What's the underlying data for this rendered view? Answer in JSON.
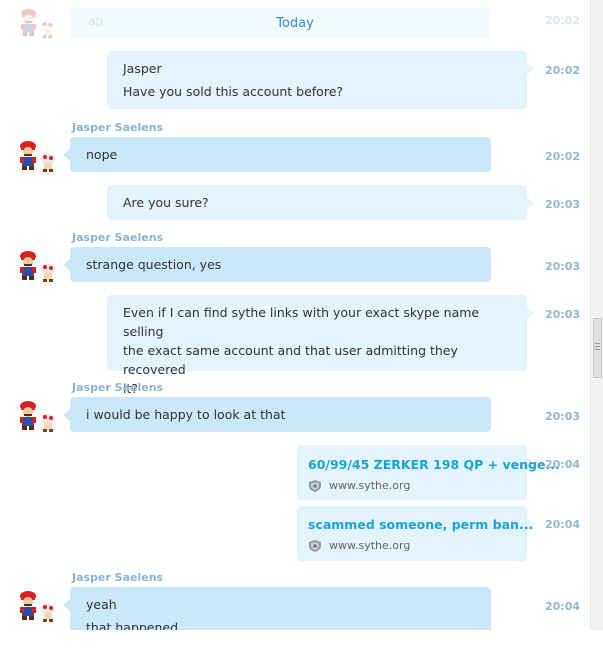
{
  "previous": {
    "text": "ap",
    "time": "20:02"
  },
  "date_separator": "Today",
  "messages": [
    {
      "sender": "",
      "lines": [
        "Jasper",
        "Have you sold this account before?"
      ],
      "time": "20:02"
    },
    {
      "sender": "Jasper Saelens",
      "lines": [
        "nope"
      ],
      "time": "20:02"
    },
    {
      "sender": "",
      "lines": [
        "Are you sure?"
      ],
      "time": "20:03"
    },
    {
      "sender": "Jasper Saelens",
      "lines": [
        "strange question, yes"
      ],
      "time": "20:03"
    },
    {
      "sender": "",
      "lines": [
        "Even if I can find sythe links with your exact skype name selling",
        "the exact same account and that user admitting they recovered",
        "it?"
      ],
      "time": "20:03"
    },
    {
      "sender": "Jasper Saelens",
      "lines": [
        "i would be happy to look at that"
      ],
      "time": "20:03"
    },
    {
      "link_title": "60/99/45 ZERKER 198 QP + venge...",
      "link_site": "www.sythe.org",
      "time": "20:04"
    },
    {
      "link_title": "scammed someone, perm ban...",
      "link_site": "www.sythe.org",
      "time": "20:04"
    },
    {
      "sender": "Jasper Saelens",
      "lines": [
        "yeah",
        "that happened"
      ],
      "time": "20:04"
    }
  ],
  "icons": {
    "avatar": "mario-avatar",
    "shield": "shield-icon"
  },
  "colors": {
    "link": "#1aa3d9",
    "time": "#8fb8d2",
    "incoming_bubble": "#c9e9f9",
    "outgoing_bubble": "#e4f4fc"
  }
}
